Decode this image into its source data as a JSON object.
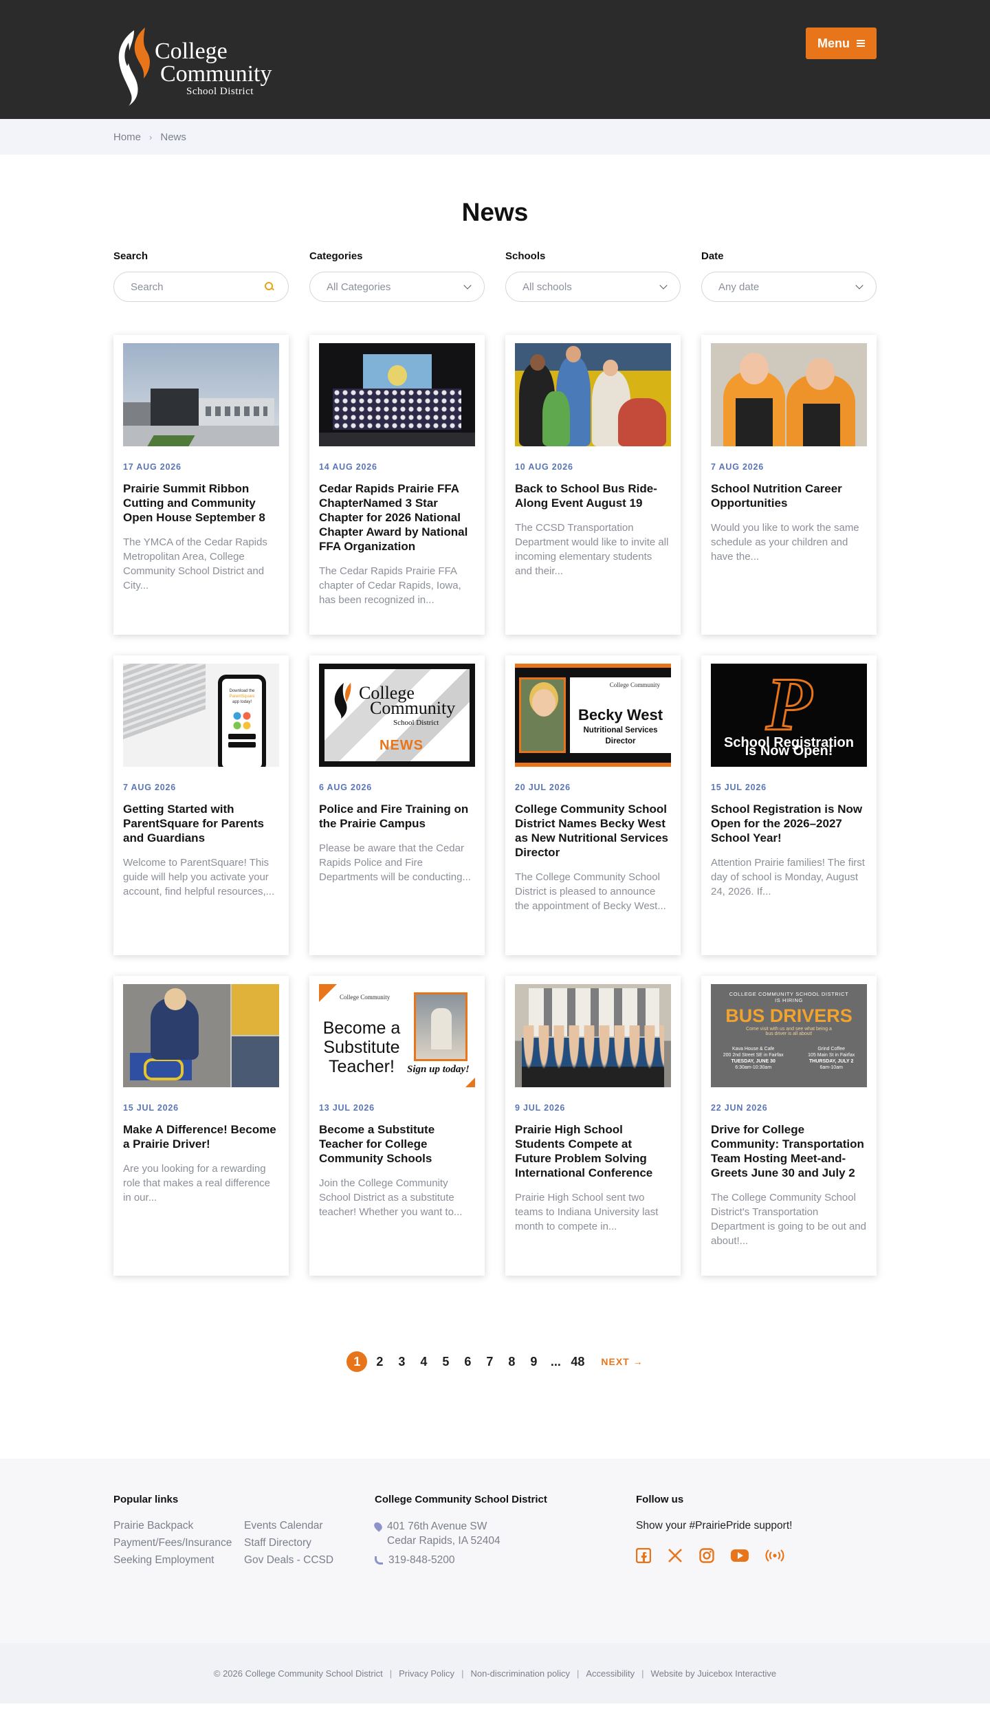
{
  "header": {
    "logo": {
      "line1": "College",
      "line2": "Community",
      "line3": "School District"
    },
    "menu_label": "Menu",
    "colors": {
      "header_bg": "#2b2b2b",
      "accent": "#e8751a"
    }
  },
  "breadcrumb": {
    "home": "Home",
    "current": "News"
  },
  "page_title": "News",
  "filters": {
    "search": {
      "label": "Search",
      "placeholder": "Search"
    },
    "categories": {
      "label": "Categories",
      "value": "All Categories"
    },
    "schools": {
      "label": "Schools",
      "value": "All schools"
    },
    "date": {
      "label": "Date",
      "value": "Any date"
    }
  },
  "articles": [
    {
      "date": "17 AUG 2026",
      "title": "Prairie Summit Ribbon Cutting and Community Open House September 8",
      "excerpt": "The YMCA of the Cedar Rapids Metropolitan Area, College Community School District and City..."
    },
    {
      "date": "14 AUG 2026",
      "title": "Cedar Rapids Prairie FFA ChapterNamed 3 Star Chapter for 2026 National Chapter Award by National FFA Organization",
      "excerpt": "The Cedar Rapids Prairie FFA chapter of Cedar Rapids, Iowa, has been recognized in..."
    },
    {
      "date": "10 AUG 2026",
      "title": "Back to School Bus Ride-Along Event August 19",
      "excerpt": "The CCSD Transportation Department would like to invite all incoming elementary students and their..."
    },
    {
      "date": "7 AUG 2026",
      "title": "School Nutrition Career Opportunities",
      "excerpt": "Would you like to work the same schedule as your children and have the..."
    },
    {
      "date": "7 AUG 2026",
      "title": "Getting Started with ParentSquare for Parents and Guardians",
      "excerpt": "Welcome to ParentSquare! This guide will help you activate your account, find helpful resources,..."
    },
    {
      "date": "6 AUG 2026",
      "title": "Police and Fire Training on the Prairie Campus",
      "excerpt": "Please be aware that the Cedar Rapids Police and Fire Departments will be conducting..."
    },
    {
      "date": "20 JUL 2026",
      "title": "College Community School District Names Becky West as New Nutritional Services Director",
      "excerpt": "The College Community School District is pleased to announce the appointment of Becky West..."
    },
    {
      "date": "15 JUL 2026",
      "title": "School Registration is Now Open for the 2026–2027 School Year!",
      "excerpt": "Attention Prairie families! The first day of school is Monday, August 24, 2026. If..."
    },
    {
      "date": "15 JUL 2026",
      "title": "Make A Difference! Become a Prairie Driver!",
      "excerpt": "Are you looking for a rewarding role that makes a real difference in our..."
    },
    {
      "date": "13 JUL 2026",
      "title": "Become a Substitute Teacher for College Community Schools",
      "excerpt": "Join the College Community School District as a substitute teacher! Whether you want to..."
    },
    {
      "date": "9 JUL 2026",
      "title": "Prairie High School Students Compete at Future Problem Solving International Conference",
      "excerpt": "Prairie High School sent two teams to Indiana University last month to compete in..."
    },
    {
      "date": "22 JUN 2026",
      "title": "Drive for College Community: Transportation Team Hosting Meet-and-Greets June 30 and July 2",
      "excerpt": "The College Community School District's Transportation Department is going to be out and about!..."
    }
  ],
  "image_text": {
    "ps": {
      "l1": "Download the",
      "l2": "ParentSquare",
      "l3": "app today!"
    },
    "news": {
      "t1": "College",
      "t2": "Community",
      "t3": "School District",
      "t4": "NEWS"
    },
    "becky": {
      "name": "Becky West",
      "role1": "Nutritional Services",
      "role2": "Director",
      "mini": "College Community"
    },
    "reg": {
      "p": "P",
      "l1": "School Registration",
      "l2": "Is Now Open!"
    },
    "sub": {
      "big": "Become a Substitute Teacher!",
      "sign": "Sign up today!",
      "mini": "College Community"
    },
    "busdr": {
      "top1": "COLLEGE COMMUNITY SCHOOL DISTRICT",
      "top2": "IS HIRING",
      "title": "BUS DRIVERS",
      "sub1": "Come visit with us and see what being a",
      "sub2": "bus driver is all about!",
      "loc1": "Kava House & Cafe",
      "addr1": "200 2nd Street SE in Fairfax",
      "day1": "TUESDAY, JUNE 30",
      "time1": "6:30am-10:30am",
      "loc2": "Grind Coffee",
      "addr2": "105 Main St in Fairfax",
      "day2": "THURSDAY, JULY 2",
      "time2": "6am-10am"
    }
  },
  "pagination": {
    "pages": [
      "1",
      "2",
      "3",
      "4",
      "5",
      "6",
      "7",
      "8",
      "9"
    ],
    "ellipsis": "...",
    "last": "48",
    "next": "NEXT →"
  },
  "footer": {
    "popular_title": "Popular links",
    "links": [
      "Prairie Backpack",
      "Events Calendar",
      "Payment/Fees/Insurance",
      "Staff Directory",
      "Seeking Employment",
      "Gov Deals - CCSD"
    ],
    "district_title": "College Community School District",
    "address1": "401 76th Avenue SW",
    "address2": "Cedar Rapids, IA 52404",
    "phone": "319-848-5200",
    "follow_title": "Follow us",
    "follow_text": "Show your #PrairiePride support!",
    "social_icons": [
      "facebook-icon",
      "x-icon",
      "instagram-icon",
      "youtube-icon",
      "podcast-icon"
    ]
  },
  "bottom": {
    "copyright": "© 2026 College Community School District",
    "privacy": "Privacy Policy",
    "nondiscrimination": "Non-discrimination policy",
    "accessibility": "Accessibility",
    "credit": "Website by Juicebox Interactive"
  }
}
